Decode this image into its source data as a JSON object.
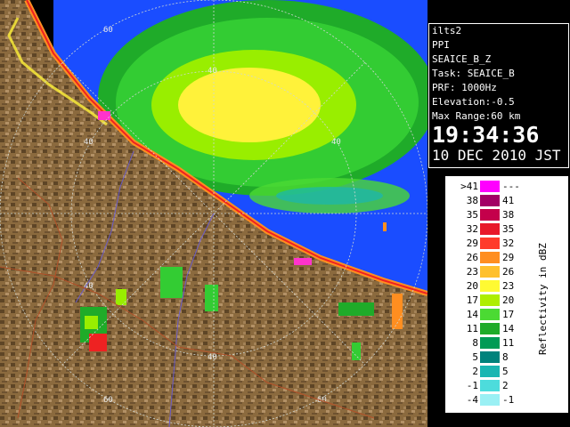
{
  "radar_panel": {
    "range_labels": [
      "60",
      "40",
      "40",
      "40",
      "40",
      "40",
      "60",
      "60"
    ],
    "colors": {
      "background": "#000000",
      "sea_clutter": "#1a4dff",
      "land_brown": "#8b6a3e",
      "land_dark": "#5e4526",
      "land_light": "#b39166",
      "echo_green": "#33cc33",
      "echo_lime": "#99ee00",
      "echo_yellow": "#fff23a",
      "echo_red": "#ee2222",
      "echo_magenta": "#ff33cc",
      "ring_color": "#cfd7d2",
      "river_color": "#6a5cc9",
      "boundary_color": "#b25028"
    }
  },
  "info_panel": {
    "site": "ilts2",
    "mode": "PPI",
    "product": "SEAICE_B_Z",
    "task": "Task: SEAICE_B",
    "prf": "PRF: 1000Hz",
    "elevation": "Elevation:-0.5",
    "max_range": "Max Range:60 km",
    "time": "19:34:36",
    "date": "10 DEC 2010 JST"
  },
  "legend": {
    "title": "Reflectivity in dBZ",
    "rows": [
      {
        "lo": ">41",
        "hi": "---",
        "color": "#ff00ff"
      },
      {
        "lo": "38",
        "hi": "41",
        "color": "#a20066"
      },
      {
        "lo": "35",
        "hi": "38",
        "color": "#c4004b"
      },
      {
        "lo": "32",
        "hi": "35",
        "color": "#e8182a"
      },
      {
        "lo": "29",
        "hi": "32",
        "color": "#ff3b2b"
      },
      {
        "lo": "26",
        "hi": "29",
        "color": "#ff8e20"
      },
      {
        "lo": "23",
        "hi": "26",
        "color": "#ffc02d"
      },
      {
        "lo": "20",
        "hi": "23",
        "color": "#fffa32"
      },
      {
        "lo": "17",
        "hi": "20",
        "color": "#aeee00"
      },
      {
        "lo": "14",
        "hi": "17",
        "color": "#4bda33"
      },
      {
        "lo": "11",
        "hi": "14",
        "color": "#1fab29"
      },
      {
        "lo": "8",
        "hi": "11",
        "color": "#009b55"
      },
      {
        "lo": "5",
        "hi": "8",
        "color": "#00837c"
      },
      {
        "lo": "2",
        "hi": "5",
        "color": "#1ab6b2"
      },
      {
        "lo": "-1",
        "hi": "2",
        "color": "#4ddcdc"
      },
      {
        "lo": "-4",
        "hi": "-1",
        "color": "#9af0f4"
      }
    ]
  }
}
